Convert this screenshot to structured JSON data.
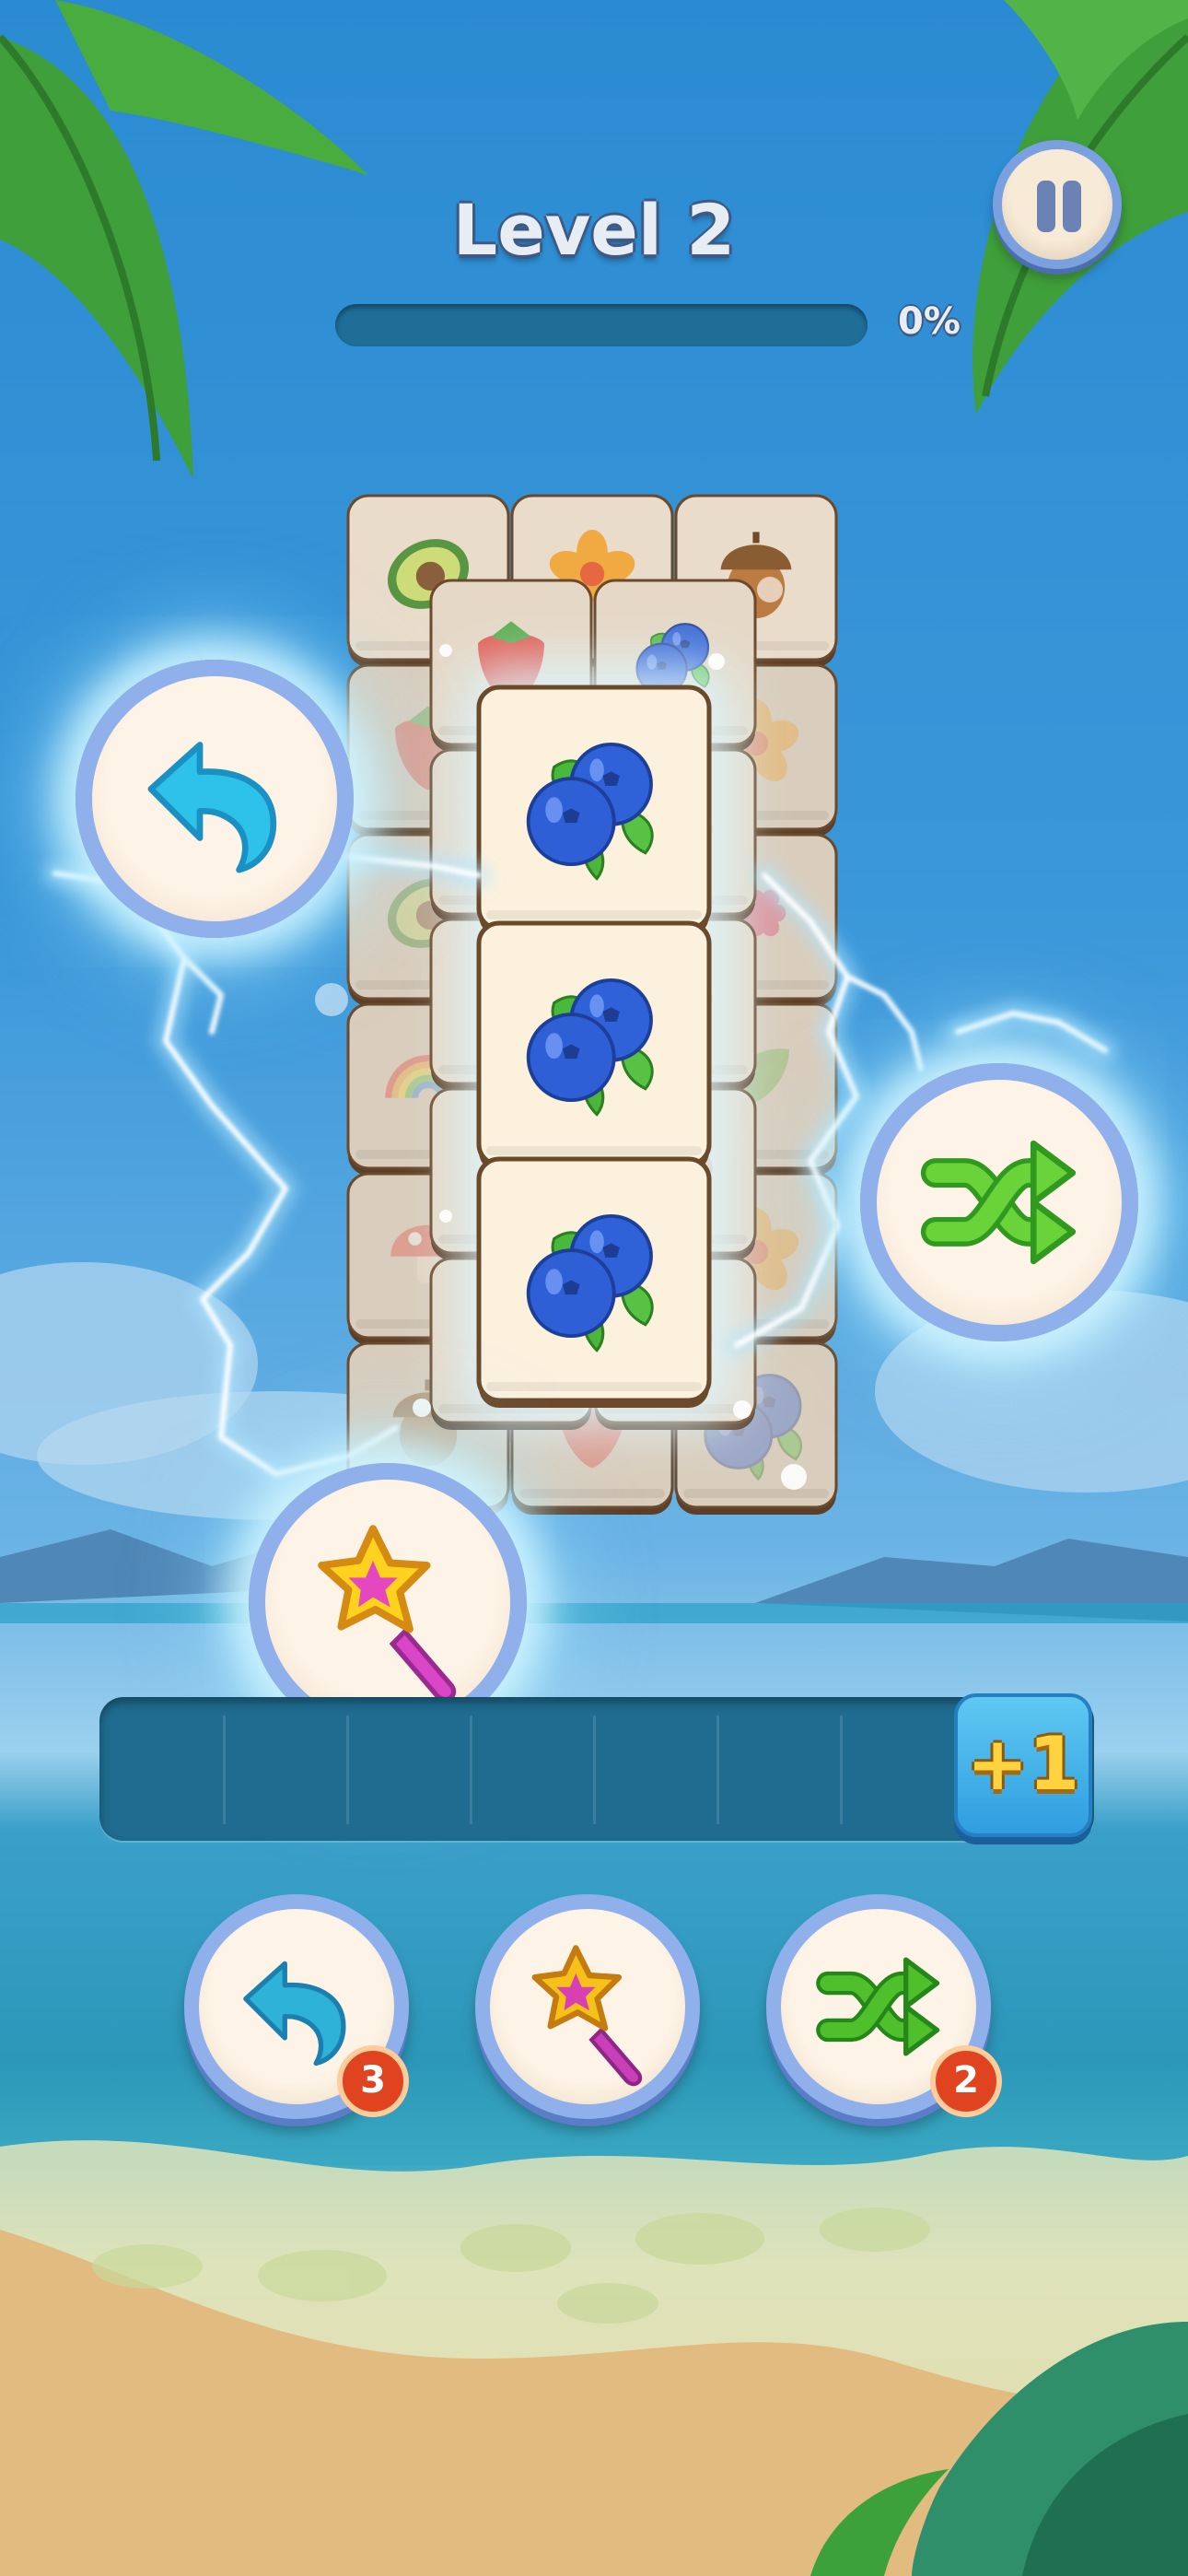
{
  "level": {
    "title": "Level 2",
    "progress_percent": 0,
    "progress_label": "0%"
  },
  "tray": {
    "slots": 7,
    "extra_slot_button_label": "+1"
  },
  "powerups": [
    {
      "name": "undo",
      "count": "3"
    },
    {
      "name": "magic-wand",
      "count": null
    },
    {
      "name": "shuffle",
      "count": "2"
    }
  ],
  "matched_tiles": [
    "blueberry",
    "blueberry",
    "blueberry"
  ],
  "board_tiles": [
    "avocado",
    "flower",
    "acorn",
    "strawberry",
    "blueberry",
    "flower",
    "avocado",
    "blueberry",
    "raspberry",
    "rainbow",
    "mushroom",
    "leaf",
    "mushroom"
  ],
  "colors": {
    "tile_face": "#fbf1dd",
    "tile_border": "#6b4a2c",
    "glow": "#d6f4ff",
    "badge": "#e0431f"
  }
}
